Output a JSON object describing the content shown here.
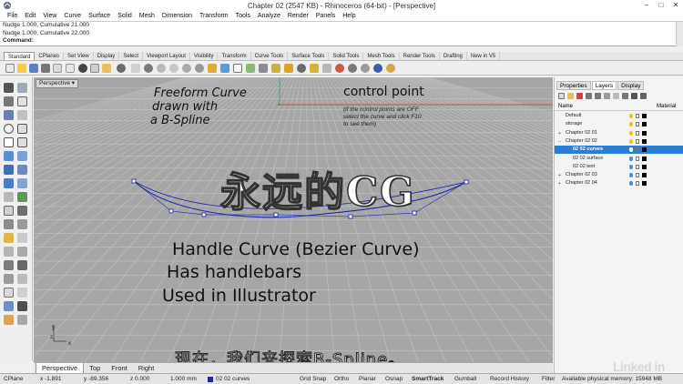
{
  "window": {
    "title": "Chapter 02 (2547 KB) - Rhinoceros (64-bit) - [Perspective]"
  },
  "menu": [
    "File",
    "Edit",
    "View",
    "Curve",
    "Surface",
    "Solid",
    "Mesh",
    "Dimension",
    "Transform",
    "Tools",
    "Analyze",
    "Render",
    "Panels",
    "Help"
  ],
  "command_history": [
    "Nudge 1.000, Cumulative 21.000",
    "Nudge 1.000, Cumulative 22.000"
  ],
  "command_prompt": "Command:",
  "toolbar_tabs": [
    "Standard",
    "CPlanes",
    "Set View",
    "Display",
    "Select",
    "Viewport Layout",
    "Visibility",
    "Transform",
    "Curve Tools",
    "Surface Tools",
    "Solid Tools",
    "Mesh Tools",
    "Render Tools",
    "Drafting",
    "New in V5"
  ],
  "viewport": {
    "label": "Perspective",
    "annotations": {
      "freeform_line1": "Freeform Curve",
      "freeform_line2": "drawn with",
      "freeform_line3": "a B-Spline",
      "control_point": "control point",
      "note_line1": "(if the control points are OFF",
      "note_line2": "select the curve and click F10",
      "note_line3": "to see them)",
      "handle_line1": "Handle Curve (Bezier Curve)",
      "handle_line2": "Has handlebars",
      "handle_line3": "Used in Illustrator"
    },
    "watermark": "永远的CG",
    "subtitle": "现在，我们来探索B-Spline。",
    "axis_labels": {
      "x": "x",
      "y": "y",
      "z": "z"
    }
  },
  "view_tabs": [
    "Perspective",
    "Top",
    "Front",
    "Right"
  ],
  "panel": {
    "tabs": [
      "Properties",
      "Layers",
      "Display"
    ],
    "columns": {
      "name": "Name",
      "material": "Material"
    },
    "layers": [
      {
        "name": "Default",
        "level": 0,
        "expander": "",
        "bulb": "#f0c419",
        "selected": false
      },
      {
        "name": "storage",
        "level": 0,
        "expander": "",
        "bulb": "#f0c419",
        "selected": false
      },
      {
        "name": "Chapter 02 01",
        "level": 0,
        "expander": "+",
        "bulb": "#f0c419",
        "selected": false
      },
      {
        "name": "Chapter 02 02",
        "level": 0,
        "expander": "−",
        "bulb": "#f0c419",
        "selected": false
      },
      {
        "name": "02 02 curves",
        "level": 1,
        "expander": "",
        "bulb": "#ffffff",
        "selected": true
      },
      {
        "name": "02 02 surface",
        "level": 1,
        "expander": "",
        "bulb": "#4a90d9",
        "selected": false
      },
      {
        "name": "02 02 text",
        "level": 1,
        "expander": "",
        "bulb": "#4a90d9",
        "selected": false
      },
      {
        "name": "Chapter 02 03",
        "level": 0,
        "expander": "+",
        "bulb": "#4a90d9",
        "selected": false
      },
      {
        "name": "Chapter 02 04",
        "level": 0,
        "expander": "+",
        "bulb": "#4a90d9",
        "selected": false
      }
    ]
  },
  "status": {
    "cplane": "CPlane",
    "x": "x -1.891",
    "y": "y -89.356",
    "z": "z 0.000",
    "units": "1.000 mm",
    "layer": "02 02 curves",
    "grid_snap": "Grid Snap",
    "ortho": "Ortho",
    "planar": "Planar",
    "osnap": "Osnap",
    "smarttrack": "SmartTrack",
    "gumball": "Gumball",
    "record_history": "Record History",
    "filter": "Filter",
    "memory": "Available physical memory: 15948 MB"
  },
  "brand": "Linked in",
  "colors": {
    "curve": "#1d2aa8",
    "control_polygon": "#2b3fb8",
    "selected_layer": "#2a7fd4",
    "viewport_bg": "#a6a6a6",
    "grid": "#c2c2c2"
  }
}
